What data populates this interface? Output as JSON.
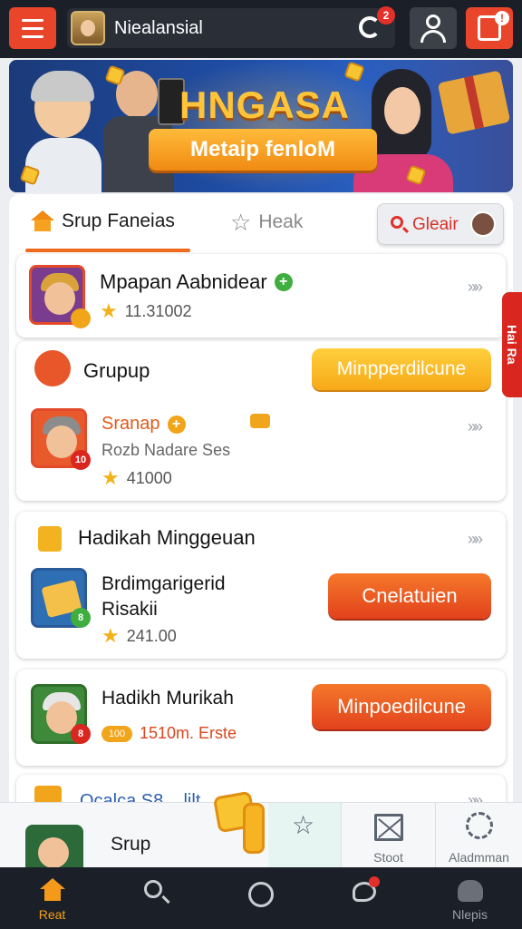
{
  "header": {
    "title": "Niealansial",
    "notif_count": "2",
    "alert_mark": "!"
  },
  "banner": {
    "title": "HNGASA",
    "cta": "Metaip fenloM"
  },
  "tabs": {
    "home_label": "Srup Faneias",
    "star_label": "Heak",
    "search_label": "Gleair"
  },
  "cards": [
    {
      "title": "Mpapan Aabnidear",
      "rating": "11.31002",
      "chev": "»»"
    },
    {
      "header": "Grupup",
      "action": "Minpperdilcune",
      "title": "Sranap",
      "subtitle": "Rozb Nadare Ses",
      "rating": "41000",
      "chev": "»»",
      "badge": "10"
    },
    {
      "header": "Hadikah Minggeuan",
      "title": "Brdimgarigerid Risakii",
      "rating": "241.00",
      "action": "Cnelatuien",
      "chev": "»»",
      "badge": "8"
    },
    {
      "title": "Hadikh Murikah",
      "meta_pill": "100",
      "meta": "1510m. Erste",
      "action": "Minpoedilcune",
      "badge": "8"
    },
    {
      "title": "Ocalca S8... lilt",
      "chev": "»»"
    }
  ],
  "side_tab": "Hai Ra",
  "dock": {
    "label": "Srup",
    "store_label": "Stoot",
    "gear_label": "Aladmman"
  },
  "nav": {
    "home_label": "Reat",
    "more_label": "Nlepis"
  },
  "colors": {
    "accent": "#e8452a",
    "cta_yellow": "#f7a918",
    "cta_orange": "#e2421c",
    "dark": "#1b1f27"
  }
}
